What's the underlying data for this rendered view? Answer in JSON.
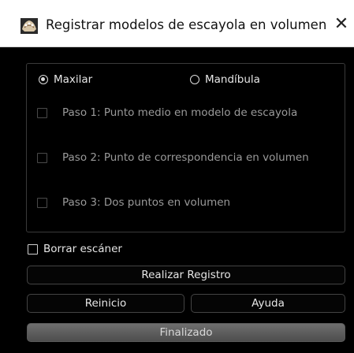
{
  "window": {
    "title": "Registrar modelos de escayola en volumen",
    "close_glyph": "✕",
    "app_icon": "dental-cast-icon"
  },
  "radios": [
    {
      "label": "Maxilar",
      "checked": true
    },
    {
      "label": "Mandíbula",
      "checked": false
    }
  ],
  "steps": [
    {
      "label": "Paso 1: Punto medio en modelo de escayola",
      "checked": false,
      "enabled": false
    },
    {
      "label": "Paso 2: Punto de correspondencia en volumen",
      "checked": false,
      "enabled": false
    },
    {
      "label": "Paso 3: Dos puntos en volumen",
      "checked": false,
      "enabled": false
    }
  ],
  "borrar_escaner": {
    "label": "Borrar escáner",
    "checked": false
  },
  "buttons": {
    "realizar_registro": "Realizar Registro",
    "reinicio": "Reinicio",
    "ayuda": "Ayuda",
    "finalizado": "Finalizado"
  },
  "colors": {
    "background": "#000000",
    "titlebar": "#ffffff",
    "text": "#e6e6e6",
    "disabled_text": "#9a9a9a",
    "border": "#444444"
  }
}
